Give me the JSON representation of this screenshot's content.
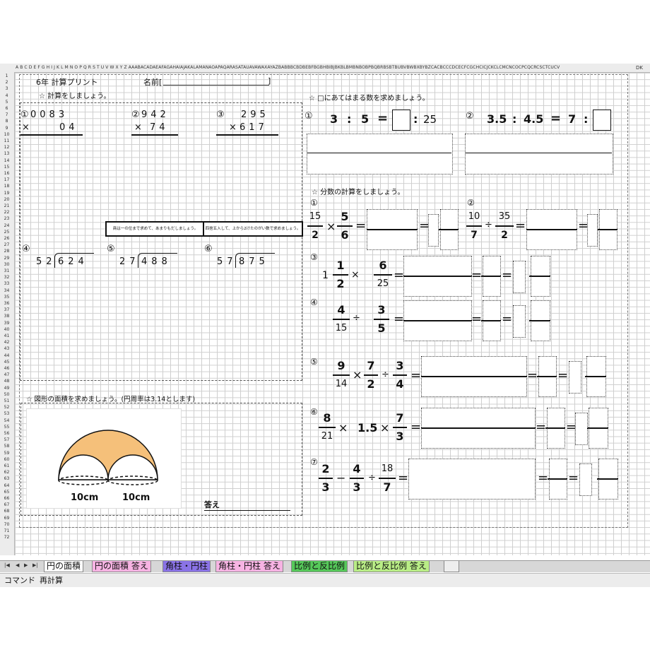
{
  "columns_header": "A B C D E F G H I  J  K L M N O P Q R S T U V W X Y Z AAABACADAEAFAGAHAIAJAKALAMANAOAPAQARASATAUAVAWAXAYAZBABBBCBDBEBFBGBHBIBJBKBLBMBNBOBPBQBRBSBTBUBVBWBXBYBZCACBCCCDCECFCGCHCICJCKCLCMCNCOCPCQCRCSCTCUCV",
  "columns_header_end": "DK",
  "rows": [
    "1",
    "2",
    "3",
    "4",
    "5",
    "6",
    "7",
    "8",
    "9",
    "10",
    "11",
    "12",
    "13",
    "14",
    "15",
    "16",
    "17",
    "18",
    "19",
    "20",
    "21",
    "22",
    "23",
    "24",
    "25",
    "26",
    "27",
    "28",
    "29",
    "30",
    "31",
    "32",
    "33",
    "34",
    "35",
    "36",
    "37",
    "38",
    "39",
    "40",
    "41",
    "42",
    "43",
    "44",
    "45",
    "46",
    "47",
    "48",
    "49",
    "50",
    "51",
    "52",
    "53",
    "54",
    "55",
    "56",
    "57",
    "58",
    "59",
    "60",
    "61",
    "62",
    "63",
    "64",
    "65",
    "66",
    "67",
    "68",
    "69",
    "70",
    "71",
    "72"
  ],
  "header": {
    "grade_title": "6年  計算プリント",
    "name_label": "名前[",
    "name_close": "]"
  },
  "left": {
    "section1_title": "☆ 計算をしましょう。",
    "mult": [
      {
        "num": "①",
        "top": "0083",
        "sign": "×",
        "bottom": "04"
      },
      {
        "num": "②",
        "top": "942",
        "sign": "×",
        "bottom": "74"
      },
      {
        "num": "③",
        "top": "295",
        "sign": "×",
        "bottom": "617"
      }
    ],
    "note_left": "商は一の位まで求めて、あまりもだしましょう。",
    "note_right": "四捨五入して、上から2けたのがい数で求めましょう。",
    "div": [
      {
        "num": "④",
        "divisor": "52",
        "dividend": "624"
      },
      {
        "num": "⑤",
        "divisor": "27",
        "dividend": "488"
      },
      {
        "num": "⑥",
        "divisor": "57",
        "dividend": "875"
      }
    ],
    "section2_title": "☆ 図形の面積を求めましょう。(円周率は3.14とします)",
    "fig_label_1": "10cm",
    "fig_label_2": "10cm",
    "answer_label": "答え"
  },
  "right": {
    "section1_title": "☆ □にあてはまる数を求めましょう。",
    "ratio1": {
      "num": "①",
      "a": "3",
      "colon": ":",
      "b": "5",
      "eq": "=",
      "c": "25"
    },
    "ratio2": {
      "num": "②",
      "a": "3.5",
      "colon": ":",
      "b": "4.5",
      "eq": "=",
      "c": "7"
    },
    "section2_title": "☆ 分数の計算をしましょう。",
    "p1": {
      "num": "①",
      "f1n": "15",
      "f1d": "2",
      "op": "×",
      "f2n": "5",
      "f2d": "6"
    },
    "p2": {
      "num": "②",
      "f1n": "10",
      "f1d": "7",
      "op": "÷",
      "f2n": "35",
      "f2d": "2"
    },
    "p3": {
      "num": "③",
      "whole": "1",
      "f1n": "1",
      "f1d": "2",
      "op": "×",
      "f2n": "6",
      "f2d": "25"
    },
    "p4": {
      "num": "④",
      "f1n": "4",
      "f1d": "15",
      "op": "÷",
      "f2n": "3",
      "f2d": "5"
    },
    "p5": {
      "num": "⑤",
      "f1n": "9",
      "f1d": "14",
      "op1": "×",
      "f2n": "7",
      "f2d": "2",
      "op2": "÷",
      "f3n": "3",
      "f3d": "4"
    },
    "p6": {
      "num": "⑥",
      "f1n": "8",
      "f1d": "21",
      "op1": "×",
      "mid": "1.5",
      "op2": "×",
      "f2n": "7",
      "f2d": "3"
    },
    "p7": {
      "num": "⑦",
      "f1n": "2",
      "f1d": "3",
      "op1": "−",
      "f2n": "4",
      "f2d": "3",
      "op2": "÷",
      "f3n": "18",
      "f3d": "7"
    },
    "eq": "="
  },
  "tabs": [
    {
      "label": "円の面積",
      "color": "#ffffff"
    },
    {
      "label": "円の面積  答え",
      "color": "#f7b3e3"
    },
    {
      "label": "角柱・円柱",
      "color": "#8a73e6"
    },
    {
      "label": "角柱・円柱  答え",
      "color": "#f7b3e3"
    },
    {
      "label": "比例と反比例",
      "color": "#56c85a"
    },
    {
      "label": "比例と反比例  答え",
      "color": "#b9ed86"
    }
  ],
  "status": {
    "label1": "コマンド",
    "label2": "再計算"
  },
  "colors": {
    "figure_fill": "#f5c07a",
    "tab_active": "#ffffff"
  }
}
